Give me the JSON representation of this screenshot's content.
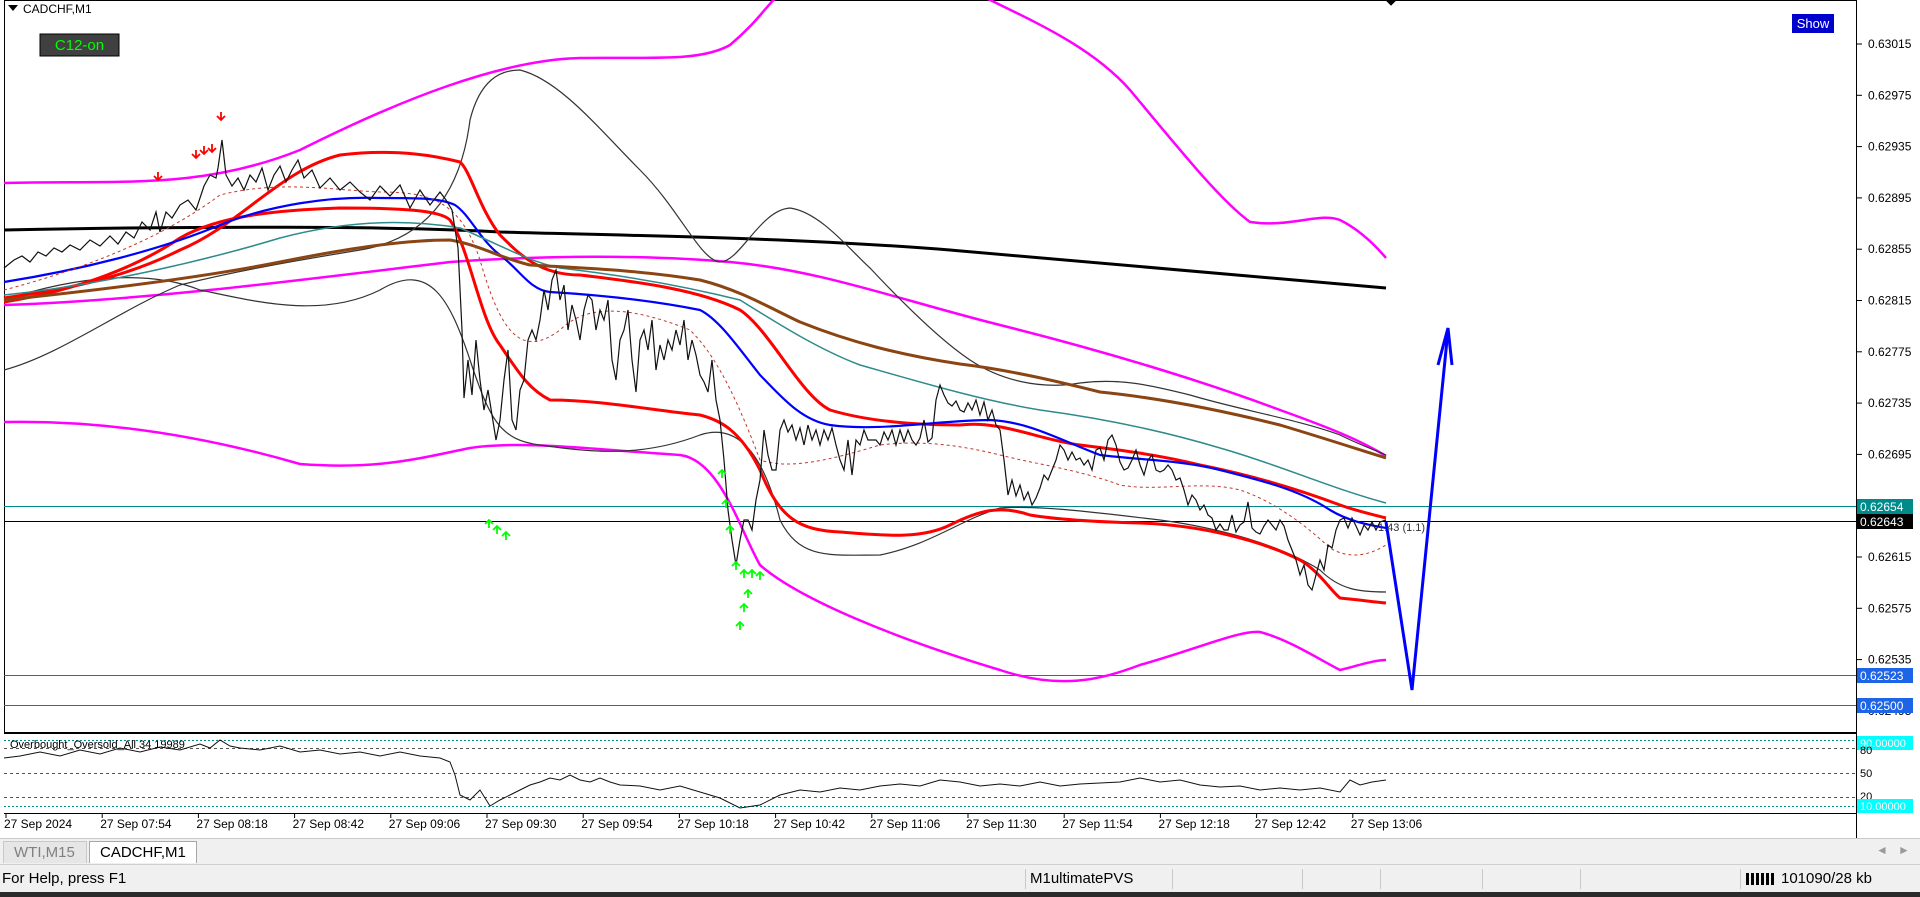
{
  "chart_window": {
    "title": "CADCHF,M1",
    "button_c12": "C12-on",
    "button_show": "Show",
    "inline_label": "1.43 (1.1)"
  },
  "price_axis": {
    "ticks": [
      "0.63015",
      "0.62975",
      "0.62935",
      "0.62895",
      "0.62855",
      "0.62815",
      "0.62775",
      "0.62735",
      "0.62695",
      "0.62655",
      "0.62615",
      "0.62575",
      "0.62535",
      "0.62495"
    ],
    "markers": {
      "upper_level": "0.62654",
      "current_price": "0.62643",
      "support_1": "0.62523",
      "support_2": "0.62500"
    }
  },
  "indicator": {
    "label": "Overbought_Oversold_All 34 19989",
    "levels": {
      "top": "90.00000",
      "mid_high": "80",
      "mid": "50",
      "mid_low": "20",
      "bottom": "10.00000"
    }
  },
  "time_axis": {
    "labels": [
      "27 Sep 2024",
      "27 Sep 07:54",
      "27 Sep 08:18",
      "27 Sep 08:42",
      "27 Sep 09:06",
      "27 Sep 09:30",
      "27 Sep 09:54",
      "27 Sep 10:18",
      "27 Sep 10:42",
      "27 Sep 11:06",
      "27 Sep 11:30",
      "27 Sep 11:54",
      "27 Sep 12:18",
      "27 Sep 12:42",
      "27 Sep 13:06"
    ]
  },
  "tabs": [
    {
      "label": "WTI,M15",
      "active": false
    },
    {
      "label": "CADCHF,M1",
      "active": true
    }
  ],
  "statusbar": {
    "help": "For Help, press F1",
    "profile": "M1ultimatePVS",
    "connection": "101090/28 kb"
  },
  "colors": {
    "magenta_band": "#ff00ff",
    "red_band": "#ff0000",
    "blue_ma": "#0000ff",
    "brown_ma": "#8b4513",
    "teal_ma": "#2e8b8b",
    "black_ma": "#000000",
    "forecast_arrow": "#0000ff",
    "buy_arrow": "#00ff00",
    "sell_arrow": "#ff0000",
    "marker_teal": "#008b8b",
    "marker_black": "#000000",
    "marker_blue": "#1e64e6"
  }
}
